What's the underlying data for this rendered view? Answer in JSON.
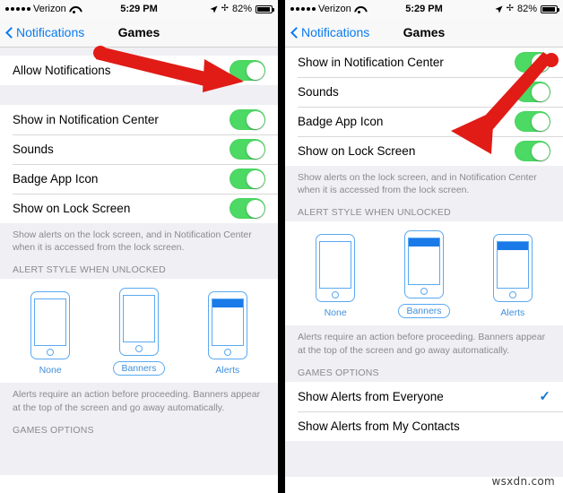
{
  "status_bar": {
    "carrier": "Verizon",
    "signal_dots": 5,
    "wifi_icon": "wifi-icon",
    "time": "5:29 PM",
    "location_icon": "location-arrow-icon",
    "bluetooth_icon": "bluetooth-icon",
    "battery_percent": "82%",
    "battery_icon": "battery-icon"
  },
  "nav": {
    "back_label": "Notifications",
    "back_icon": "chevron-left-icon",
    "title": "Games"
  },
  "colors": {
    "toggle_on": "#4CD964",
    "accent_blue": "#007AFF",
    "arrow_red": "#E11B16",
    "group_bg": "#EFEFF4",
    "illustration_blue": "#5AA9F0",
    "banner_blue": "#1A7AE8"
  },
  "left_panel": {
    "master_row": {
      "label": "Allow Notifications",
      "toggle": "on"
    },
    "rows": [
      {
        "label": "Show in Notification Center",
        "toggle": "on"
      },
      {
        "label": "Sounds",
        "toggle": "on"
      },
      {
        "label": "Badge App Icon",
        "toggle": "on"
      },
      {
        "label": "Show on Lock Screen",
        "toggle": "on"
      }
    ],
    "lock_footnote": "Show alerts on the lock screen, and in Notification Center when it is accessed from the lock screen.",
    "alert_style_header": "ALERT STYLE WHEN UNLOCKED",
    "alert_styles": [
      {
        "label": "None",
        "banner": false,
        "selected": false
      },
      {
        "label": "Banners",
        "banner": false,
        "selected": true
      },
      {
        "label": "Alerts",
        "banner": true,
        "selected": false
      }
    ],
    "alert_footnote": "Alerts require an action before proceeding. Banners appear at the top of the screen and go away automatically.",
    "games_options_header": "GAMES OPTIONS"
  },
  "right_panel": {
    "rows": [
      {
        "label": "Show in Notification Center",
        "toggle": "on"
      },
      {
        "label": "Sounds",
        "toggle": "on"
      },
      {
        "label": "Badge App Icon",
        "toggle": "on"
      },
      {
        "label": "Show on Lock Screen",
        "toggle": "on"
      }
    ],
    "lock_footnote": "Show alerts on the lock screen, and in Notification Center when it is accessed from the lock screen.",
    "alert_style_header": "ALERT STYLE WHEN UNLOCKED",
    "alert_styles": [
      {
        "label": "None",
        "banner": false,
        "selected": false
      },
      {
        "label": "Banners",
        "banner": true,
        "selected": true
      },
      {
        "label": "Alerts",
        "banner": true,
        "selected": false
      }
    ],
    "alert_footnote": "Alerts require an action before proceeding. Banners appear at the top of the screen and go away automatically.",
    "games_options_header": "GAMES OPTIONS",
    "options": [
      {
        "label": "Show Alerts from Everyone",
        "checked": true
      },
      {
        "label": "Show Alerts from My Contacts",
        "checked": false
      }
    ]
  },
  "annotations": {
    "arrow_left_target": "Allow Notifications toggle",
    "arrow_right_target": "Show Alerts from Everyone row"
  },
  "watermark": "wsxdn.com"
}
